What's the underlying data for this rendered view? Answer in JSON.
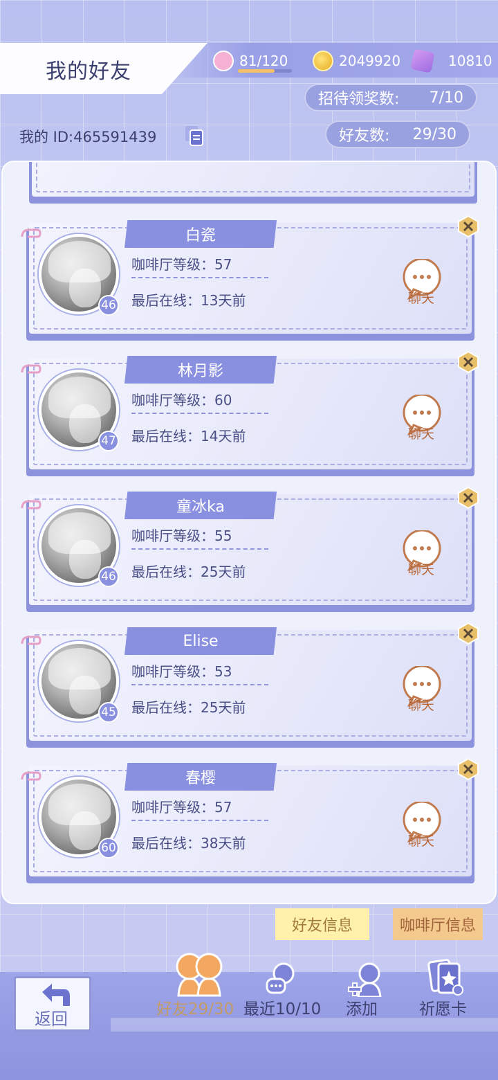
{
  "header": {
    "title": "我的好友",
    "stamina": "81/120",
    "stamina_fill": 0.675,
    "coins": "2049920",
    "gems": "10810"
  },
  "stats": {
    "reward_label": "招待领奖数:",
    "reward_value": "7/10",
    "friends_label": "好友数:",
    "friends_value": "29/30"
  },
  "my_id": "我的 ID:465591439",
  "friends": [
    {
      "name": "白瓷",
      "level_label": "咖啡厅等级：57",
      "online": "最后在线：13天前",
      "badge": "46",
      "chat": "聊天"
    },
    {
      "name": "林月影",
      "level_label": "咖啡厅等级：60",
      "online": "最后在线：14天前",
      "badge": "47",
      "chat": "聊天"
    },
    {
      "name": "童冰ka",
      "level_label": "咖啡厅等级：55",
      "online": "最后在线：25天前",
      "badge": "46",
      "chat": "聊天"
    },
    {
      "name": "Elise",
      "level_label": "咖啡厅等级：53",
      "online": "最后在线：25天前",
      "badge": "45",
      "chat": "聊天"
    },
    {
      "name": "春樱",
      "level_label": "咖啡厅等级：57",
      "online": "最后在线：38天前",
      "badge": "60",
      "chat": "聊天"
    }
  ],
  "tabs": {
    "friend_info": "好友信息",
    "cafe_info": "咖啡厅信息"
  },
  "nav": {
    "back": "返回",
    "friends": "好友29/30",
    "recent": "最近10/10",
    "add": "添加",
    "wish": "祈愿卡"
  },
  "colors": {
    "accent": "#8a90e0",
    "chat": "#b7683b",
    "active_tab": "#c29b65"
  }
}
